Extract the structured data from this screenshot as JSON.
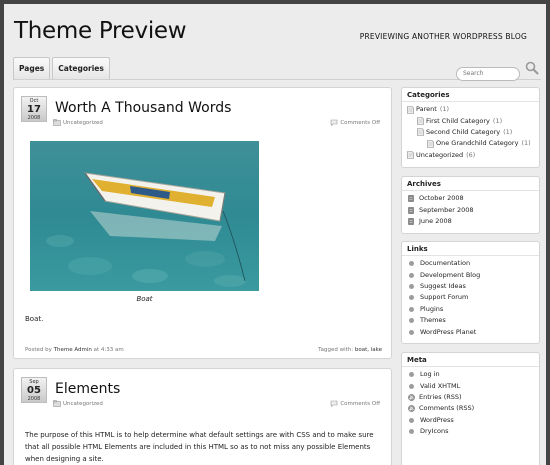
{
  "header": {
    "title": "Theme Preview",
    "description": "PREVIEWING ANOTHER WORDPRESS BLOG"
  },
  "nav": {
    "tabs": [
      "Pages",
      "Categories"
    ],
    "search_placeholder": "Search"
  },
  "posts": [
    {
      "month": "Oct",
      "day": "17",
      "year": "2008",
      "title": "Worth A Thousand Words",
      "category": "Uncategorized",
      "comments": "Comments Off",
      "caption": "Boat",
      "body": "Boat.",
      "posted_by_prefix": "Posted by",
      "author": "Theme Admin",
      "time": "at 4:33 am",
      "tagged_prefix": "Tagged with:",
      "tags": "boat, lake"
    },
    {
      "month": "Sep",
      "day": "05",
      "year": "2008",
      "title": "Elements",
      "category": "Uncategorized",
      "comments": "Comments Off",
      "body": "The purpose of this HTML is to help determine what default settings are with CSS and to make sure that all possible HTML Elements are included in this HTML so as to not miss any possible Elements when designing a site."
    }
  ],
  "sidebar": {
    "categories": {
      "title": "Categories",
      "items": [
        {
          "label": "Parent",
          "count": "(1)",
          "level": 0
        },
        {
          "label": "First Child Category",
          "count": "(1)",
          "level": 1
        },
        {
          "label": "Second Child Category",
          "count": "(1)",
          "level": 1
        },
        {
          "label": "One Grandchild Category",
          "count": "(1)",
          "level": 2
        },
        {
          "label": "Uncategorized",
          "count": "(6)",
          "level": 0
        }
      ]
    },
    "archives": {
      "title": "Archives",
      "items": [
        "October 2008",
        "September 2008",
        "June 2008"
      ]
    },
    "links": {
      "title": "Links",
      "items": [
        "Documentation",
        "Development Blog",
        "Suggest Ideas",
        "Support Forum",
        "Plugins",
        "Themes",
        "WordPress Planet"
      ]
    },
    "meta": {
      "title": "Meta",
      "items": [
        {
          "label": "Log in",
          "icon": "bullet"
        },
        {
          "label": "Valid XHTML",
          "icon": "bullet"
        },
        {
          "label": "Entries (RSS)",
          "icon": "rss-icon"
        },
        {
          "label": "Comments (RSS)",
          "icon": "rss-icon"
        },
        {
          "label": "WordPress",
          "icon": "bullet"
        },
        {
          "label": "DryIcons",
          "icon": "bullet"
        }
      ]
    }
  },
  "colors": {
    "frame": "#444444",
    "page_bg": "#ececec",
    "panel_bg": "#ffffff",
    "water": "#2f8f9a"
  }
}
